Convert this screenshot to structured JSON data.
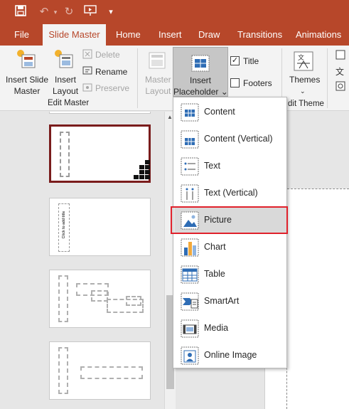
{
  "ribbon_tabs": [
    "File",
    "Slide Master",
    "Home",
    "Insert",
    "Draw",
    "Transitions",
    "Animations"
  ],
  "active_tab": "Slide Master",
  "edit_master": {
    "insert_slide_master": "Insert Slide\nMaster",
    "insert_layout": "Insert\nLayout",
    "delete": "Delete",
    "rename": "Rename",
    "preserve": "Preserve",
    "group_label": "Edit Master"
  },
  "master_layout": {
    "master_layout_label": "Master\nLayout",
    "insert_placeholder": "Insert\nPlaceholder ⌄",
    "title_label": "Title",
    "footers_label": "Footers",
    "title_checked": true,
    "footers_checked": false
  },
  "edit_theme": {
    "themes_label": "Themes",
    "group_label": "dit Theme"
  },
  "placeholder_menu": [
    {
      "label": "Content",
      "icon": "content-icon"
    },
    {
      "label": "Content (Vertical)",
      "icon": "content-vertical-icon"
    },
    {
      "label": "Text",
      "icon": "text-icon"
    },
    {
      "label": "Text (Vertical)",
      "icon": "text-vertical-icon"
    },
    {
      "label": "Picture",
      "icon": "picture-icon"
    },
    {
      "label": "Chart",
      "icon": "chart-icon"
    },
    {
      "label": "Table",
      "icon": "table-icon"
    },
    {
      "label": "SmartArt",
      "icon": "smartart-icon"
    },
    {
      "label": "Media",
      "icon": "media-icon"
    },
    {
      "label": "Online Image",
      "icon": "online-image-icon"
    }
  ],
  "highlighted_item": "Picture",
  "thumbnail_text": "Click to add title",
  "colors": {
    "accent": "#b7472a",
    "highlight_border": "#e0212b",
    "selected_thumb": "#7a1c1c"
  }
}
